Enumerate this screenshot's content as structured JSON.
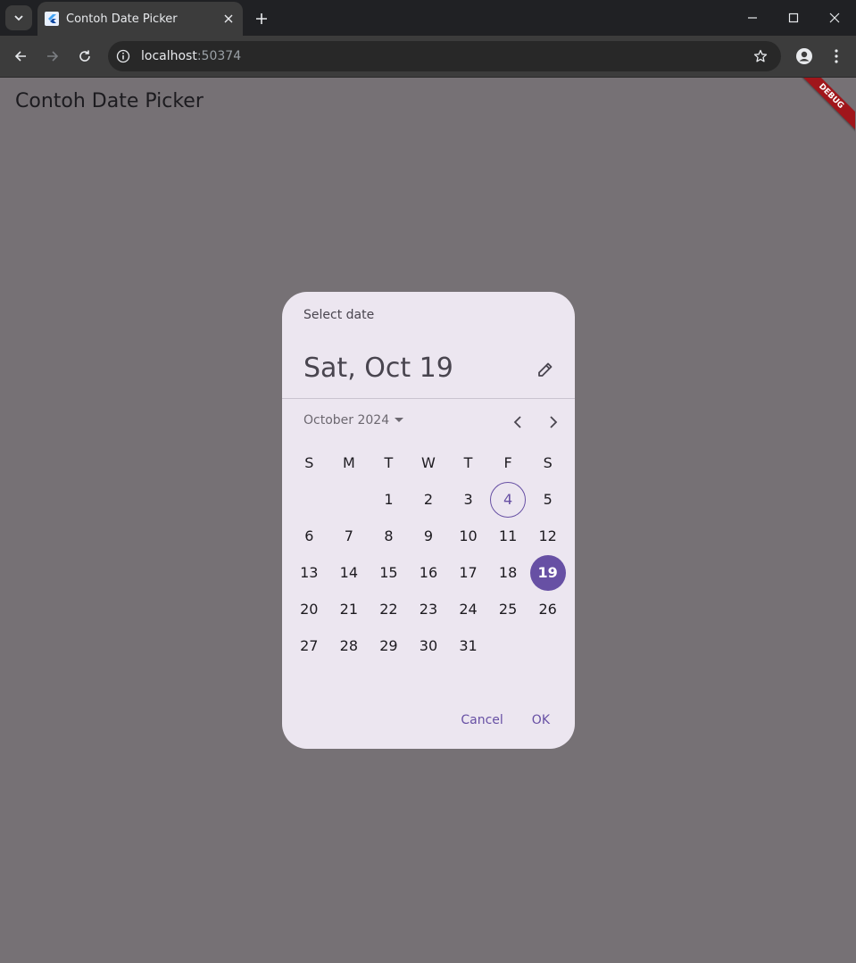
{
  "browser": {
    "tab_title": "Contoh Date Picker",
    "url_host": "localhost",
    "url_port": ":50374"
  },
  "app": {
    "title": "Contoh Date Picker",
    "debug_label": "DEBUG"
  },
  "dialog": {
    "header_label": "Select date",
    "selected_date_text": "Sat, Oct 19",
    "month_label": "October 2024",
    "weekdays": [
      "S",
      "M",
      "T",
      "W",
      "T",
      "F",
      "S"
    ],
    "leading_blank_days": 2,
    "days_in_month": 31,
    "today": 4,
    "selected": 19,
    "cancel_label": "Cancel",
    "ok_label": "OK"
  },
  "colors": {
    "accent": "#6750a4",
    "dialog_bg": "#ece6f0",
    "scrim": "#767175"
  }
}
